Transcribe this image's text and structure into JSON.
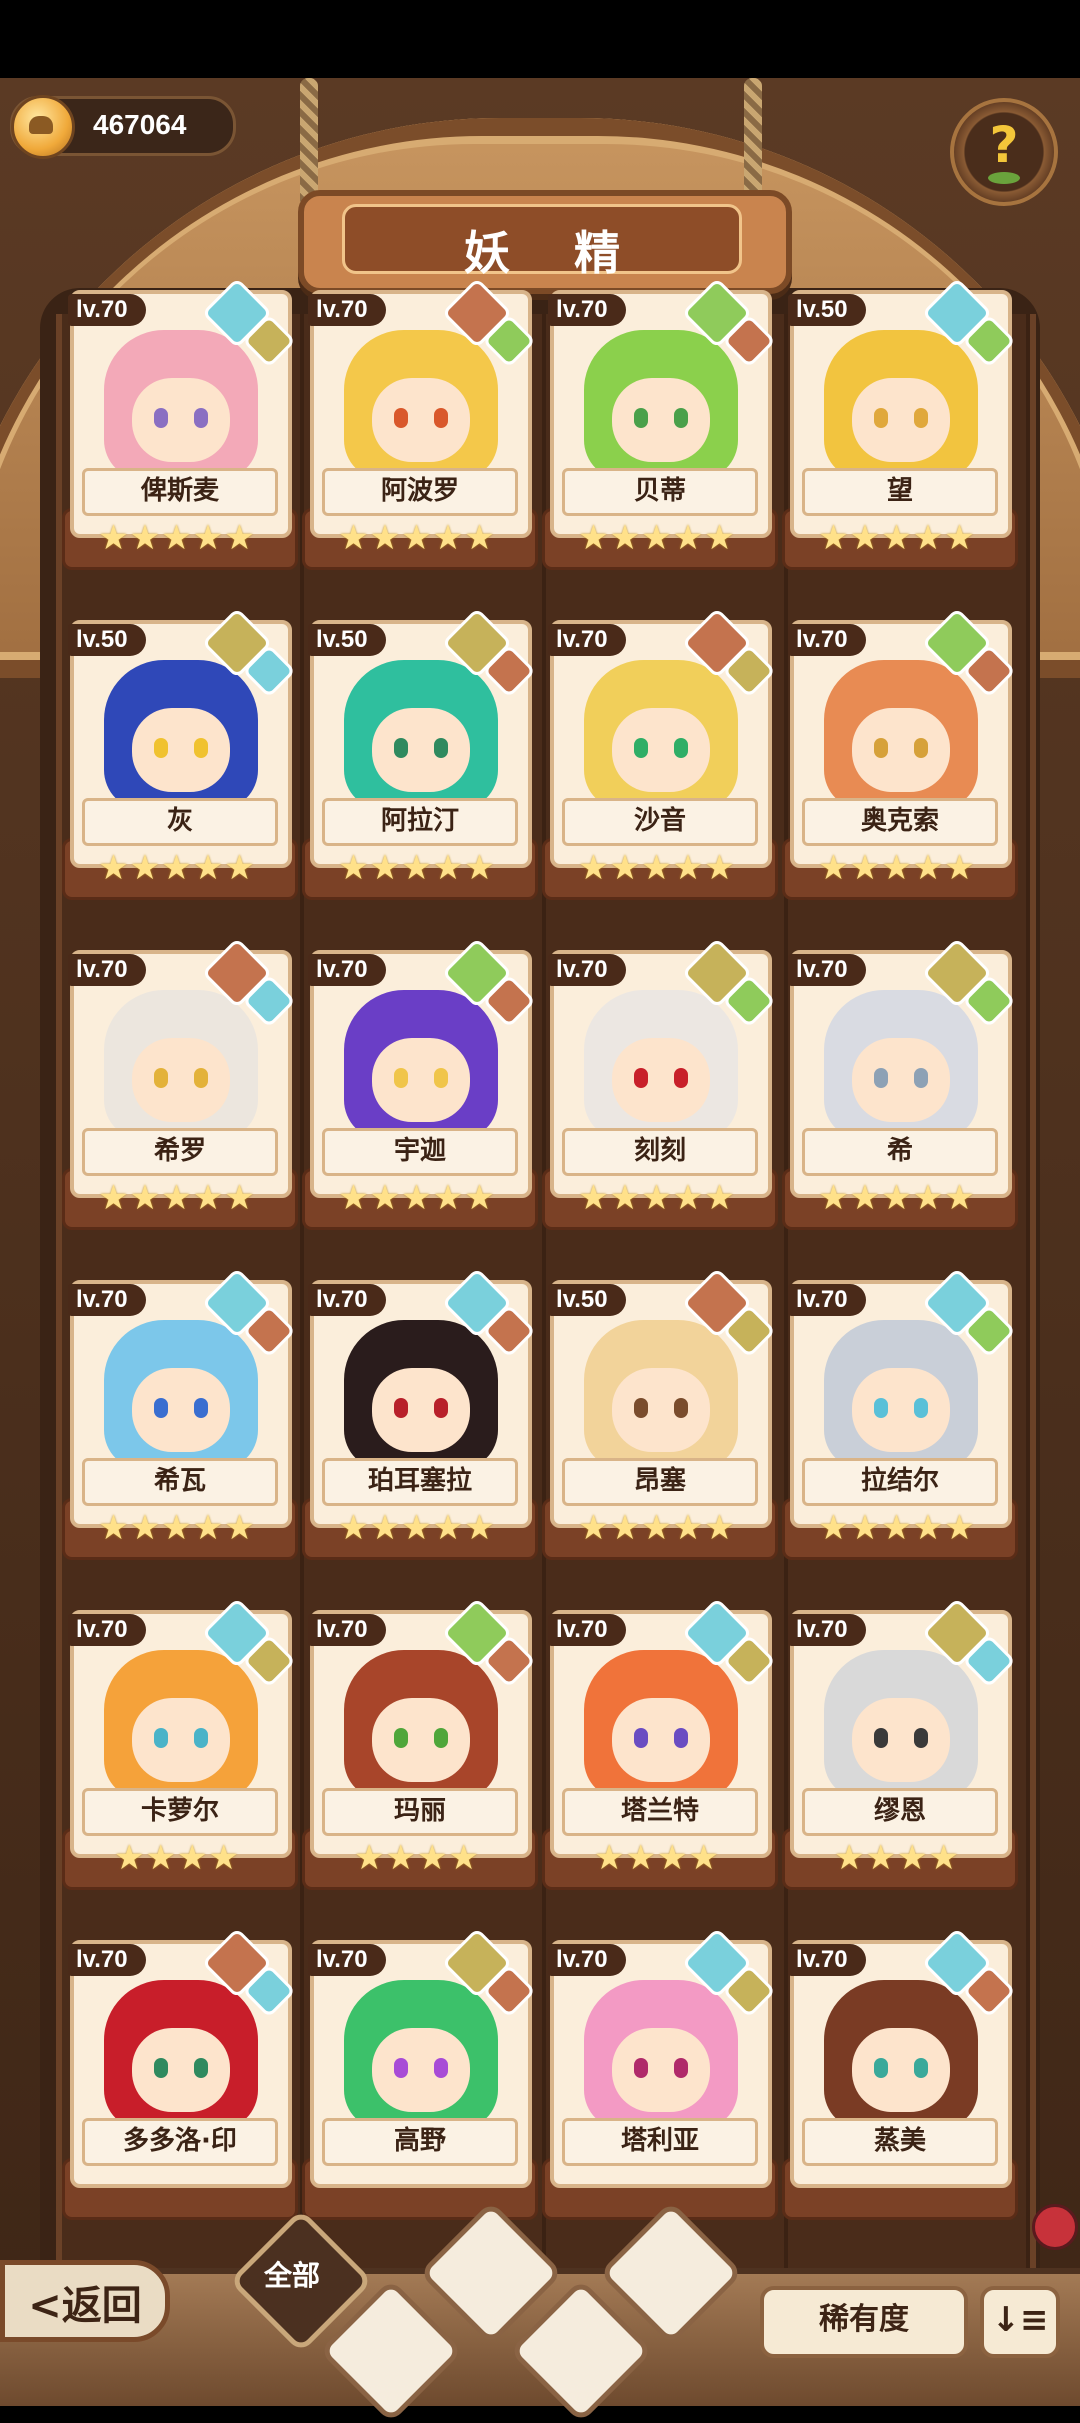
{
  "currency": {
    "amount": "467064",
    "icon": "coin-icon"
  },
  "title": "妖 精",
  "help": {
    "label": "?"
  },
  "back_label": "<返回",
  "filters": {
    "all_label": "全部"
  },
  "sort": {
    "rarity_label": "稀有度",
    "order_icon_label": "↓≡"
  },
  "cards": [
    {
      "level": "lv.70",
      "name": "俾斯麦",
      "stars": "★★★★★",
      "elements": [
        "water",
        "earth"
      ]
    },
    {
      "level": "lv.70",
      "name": "阿波罗",
      "stars": "★★★★★",
      "elements": [
        "fire",
        "wood"
      ]
    },
    {
      "level": "lv.70",
      "name": "贝蒂",
      "stars": "★★★★★",
      "elements": [
        "wood",
        "fire"
      ]
    },
    {
      "level": "lv.50",
      "name": "望",
      "stars": "★★★★★",
      "elements": [
        "water",
        "wood"
      ]
    },
    {
      "level": "lv.50",
      "name": "灰",
      "stars": "★★★★★",
      "elements": [
        "earth",
        "water"
      ]
    },
    {
      "level": "lv.50",
      "name": "阿拉汀",
      "stars": "★★★★★",
      "elements": [
        "earth",
        "fire"
      ]
    },
    {
      "level": "lv.70",
      "name": "沙音",
      "stars": "★★★★★",
      "elements": [
        "fire",
        "earth"
      ]
    },
    {
      "level": "lv.70",
      "name": "奥克索",
      "stars": "★★★★★",
      "elements": [
        "wood",
        "fire"
      ]
    },
    {
      "level": "lv.70",
      "name": "希罗",
      "stars": "★★★★★",
      "elements": [
        "fire",
        "water"
      ]
    },
    {
      "level": "lv.70",
      "name": "宇迦",
      "stars": "★★★★★",
      "elements": [
        "wood",
        "fire"
      ]
    },
    {
      "level": "lv.70",
      "name": "刻刻",
      "stars": "★★★★★",
      "elements": [
        "earth",
        "wood"
      ]
    },
    {
      "level": "lv.70",
      "name": "希",
      "stars": "★★★★★",
      "elements": [
        "earth",
        "wood"
      ]
    },
    {
      "level": "lv.70",
      "name": "希瓦",
      "stars": "★★★★★",
      "elements": [
        "water",
        "fire"
      ]
    },
    {
      "level": "lv.70",
      "name": "珀耳塞拉",
      "stars": "★★★★★",
      "elements": [
        "water",
        "fire"
      ]
    },
    {
      "level": "lv.50",
      "name": "昂塞",
      "stars": "★★★★★",
      "elements": [
        "fire",
        "earth"
      ]
    },
    {
      "level": "lv.70",
      "name": "拉结尔",
      "stars": "★★★★★",
      "elements": [
        "water",
        "wood"
      ]
    },
    {
      "level": "lv.70",
      "name": "卡萝尔",
      "stars": "★★★★",
      "elements": [
        "water",
        "earth"
      ]
    },
    {
      "level": "lv.70",
      "name": "玛丽",
      "stars": "★★★★",
      "elements": [
        "wood",
        "fire"
      ]
    },
    {
      "level": "lv.70",
      "name": "塔兰特",
      "stars": "★★★★",
      "elements": [
        "water",
        "earth"
      ]
    },
    {
      "level": "lv.70",
      "name": "缪恩",
      "stars": "★★★★",
      "elements": [
        "earth",
        "water"
      ]
    },
    {
      "level": "lv.70",
      "name": "多多洛·印",
      "stars": "",
      "elements": [
        "fire",
        "water"
      ]
    },
    {
      "level": "lv.70",
      "name": "高野",
      "stars": "",
      "elements": [
        "earth",
        "fire"
      ]
    },
    {
      "level": "lv.70",
      "name": "塔利亚",
      "stars": "",
      "elements": [
        "water",
        "earth"
      ]
    },
    {
      "level": "lv.70",
      "name": "蒸美",
      "stars": "",
      "elements": [
        "water",
        "fire"
      ]
    }
  ],
  "colors": {
    "hair": [
      "#f3a9b8",
      "#f4c84a",
      "#8bd04c",
      "#f2c43f",
      "#2f48b8",
      "#2fbf9e",
      "#f1cf5a",
      "#e88b53",
      "#ece6de",
      "#6a3ec6",
      "#ece7e2",
      "#d9dbe2",
      "#7cc7ea",
      "#2a1c1c",
      "#f2d39a",
      "#c9cfd8",
      "#f5a23a",
      "#a8452a",
      "#f0733a",
      "#d9d9d9",
      "#c81e2a",
      "#3cc16a",
      "#f39ac4",
      "#7a3b24"
    ],
    "eyes": [
      "#8a6fc2",
      "#d9582b",
      "#4aa04a",
      "#e0a83c",
      "#f0c230",
      "#2f8a5f",
      "#2fae66",
      "#d6a13a",
      "#e3b23a",
      "#f0c54a",
      "#c8202a",
      "#8da1b5",
      "#3a6ed0",
      "#b8202a",
      "#7a4c2c",
      "#5ac0d8",
      "#4ab3c8",
      "#4fa63a",
      "#6a4cc2",
      "#3a3a3a",
      "#2f8a5f",
      "#a84bd6",
      "#b02a6a",
      "#3aa99a"
    ]
  }
}
